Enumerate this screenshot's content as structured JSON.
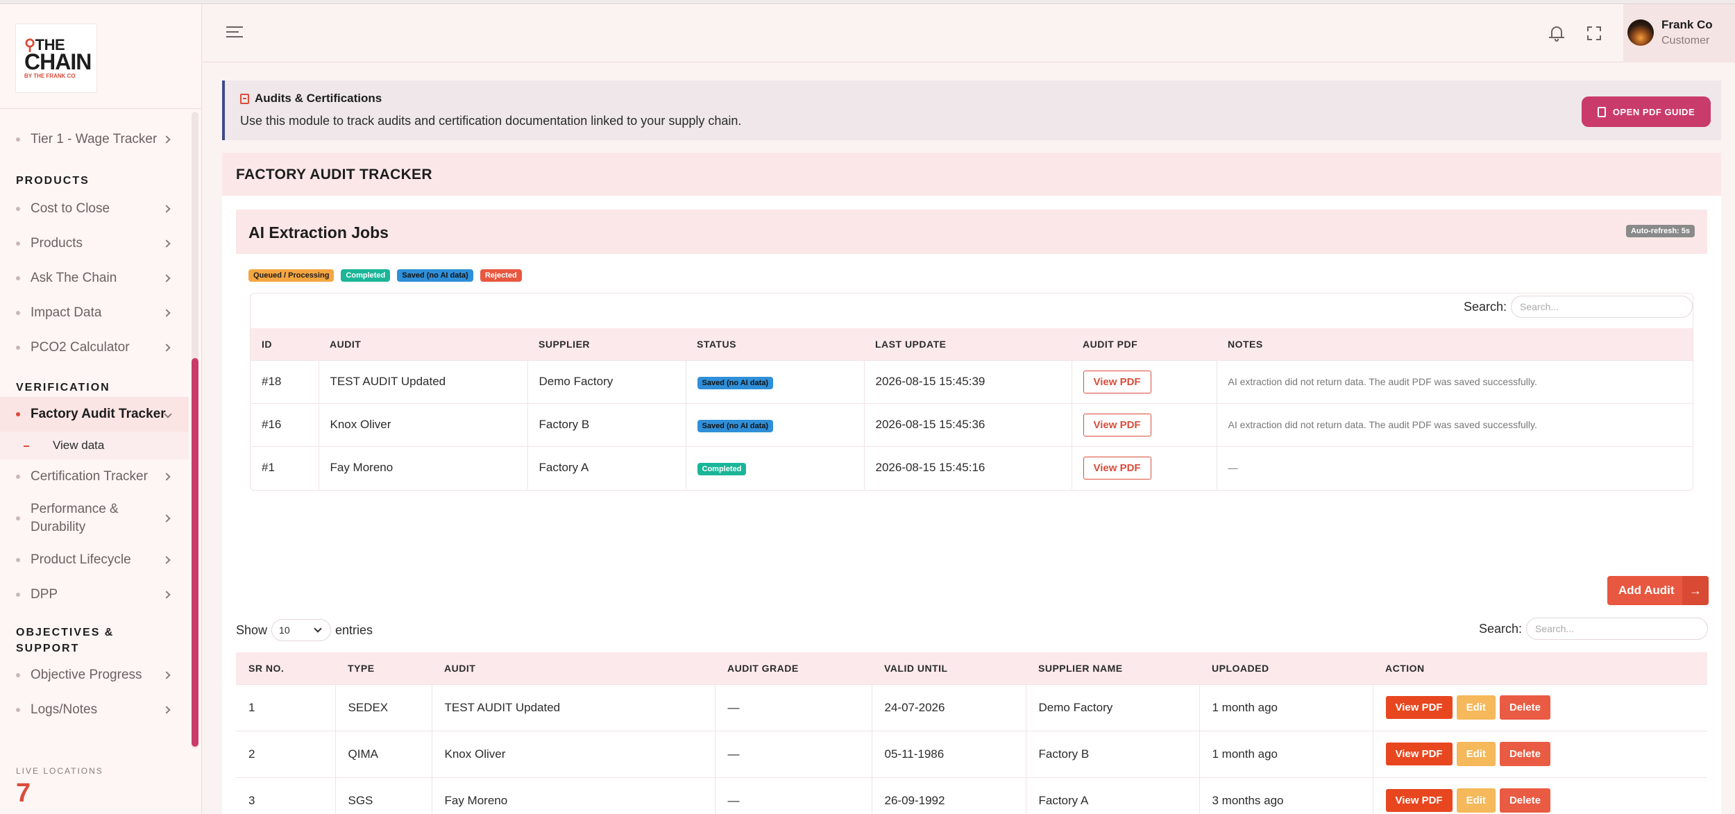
{
  "brand": {
    "logo_top": "THE",
    "logo_main": "CHAIN",
    "logo_sub": "BY THE FRANK CO"
  },
  "sidebar": {
    "items_top": [
      {
        "label": "Tier 1 - Wage Tracker"
      }
    ],
    "sections": [
      {
        "title": "PRODUCTS",
        "items": [
          "Cost to Close",
          "Products",
          "Ask The Chain",
          "Impact Data",
          "PCO2 Calculator"
        ]
      },
      {
        "title": "VERIFICATION",
        "active": "Factory Audit Tracker",
        "sub": "View data",
        "items": [
          "Certification Tracker",
          "Performance & Durability",
          "Product Lifecycle",
          "DPP"
        ]
      },
      {
        "title": "OBJECTIVES & SUPPORT",
        "items": [
          "Objective Progress",
          "Logs/Notes"
        ]
      }
    ],
    "live_label": "LIVE LOCATIONS",
    "live_count": "7"
  },
  "header": {
    "user_name": "Frank Co",
    "user_role": "Customer"
  },
  "banner": {
    "title": "Audits & Certifications",
    "text": "Use this module to track audits and certification documentation linked to your supply chain.",
    "button": "OPEN PDF GUIDE"
  },
  "page": {
    "title": "FACTORY AUDIT TRACKER"
  },
  "ai_jobs": {
    "title": "AI Extraction Jobs",
    "auto_refresh": "Auto-refresh: 5s",
    "legend": [
      "Queued / Processing",
      "Completed",
      "Saved (no AI data)",
      "Rejected"
    ],
    "search_label": "Search:",
    "search_placeholder": "Search...",
    "columns": [
      "ID",
      "AUDIT",
      "SUPPLIER",
      "STATUS",
      "LAST UPDATE",
      "AUDIT PDF",
      "NOTES"
    ],
    "rows": [
      {
        "id": "#18",
        "audit": "TEST AUDIT Updated",
        "supplier": "Demo Factory",
        "status": "Saved (no AI data)",
        "updated": "2026-08-15 15:45:39",
        "pdf": "View PDF",
        "notes": "AI extraction did not return data. The audit PDF was saved successfully."
      },
      {
        "id": "#16",
        "audit": "Knox Oliver",
        "supplier": "Factory B",
        "status": "Saved (no AI data)",
        "updated": "2026-08-15 15:45:36",
        "pdf": "View PDF",
        "notes": "AI extraction did not return data. The audit PDF was saved successfully."
      },
      {
        "id": "#1",
        "audit": "Fay Moreno",
        "supplier": "Factory A",
        "status": "Completed",
        "updated": "2026-08-15 15:45:16",
        "pdf": "View PDF",
        "notes": "—"
      }
    ]
  },
  "audits": {
    "add_button": "Add Audit",
    "show_label": "Show",
    "entries_value": "10",
    "entries_label": "entries",
    "search_label": "Search:",
    "search_placeholder": "Search...",
    "columns": [
      "SR NO.",
      "TYPE",
      "AUDIT",
      "AUDIT GRADE",
      "VALID UNTIL",
      "SUPPLIER NAME",
      "UPLOADED",
      "ACTION"
    ],
    "actions": {
      "view": "View PDF",
      "edit": "Edit",
      "delete": "Delete"
    },
    "rows": [
      {
        "sr": "1",
        "type": "SEDEX",
        "audit": "TEST AUDIT Updated",
        "grade": "—",
        "valid": "24-07-2026",
        "supplier": "Demo Factory",
        "uploaded": "1 month ago"
      },
      {
        "sr": "2",
        "type": "QIMA",
        "audit": "Knox Oliver",
        "grade": "—",
        "valid": "05-11-1986",
        "supplier": "Factory B",
        "uploaded": "1 month ago"
      },
      {
        "sr": "3",
        "type": "SGS",
        "audit": "Fay Moreno",
        "grade": "—",
        "valid": "26-09-1992",
        "supplier": "Factory A",
        "uploaded": "3 months ago"
      }
    ]
  },
  "colors": {
    "accent": "#d94d3b",
    "magenta": "#c93b6a",
    "navy": "#3d4a8a"
  }
}
